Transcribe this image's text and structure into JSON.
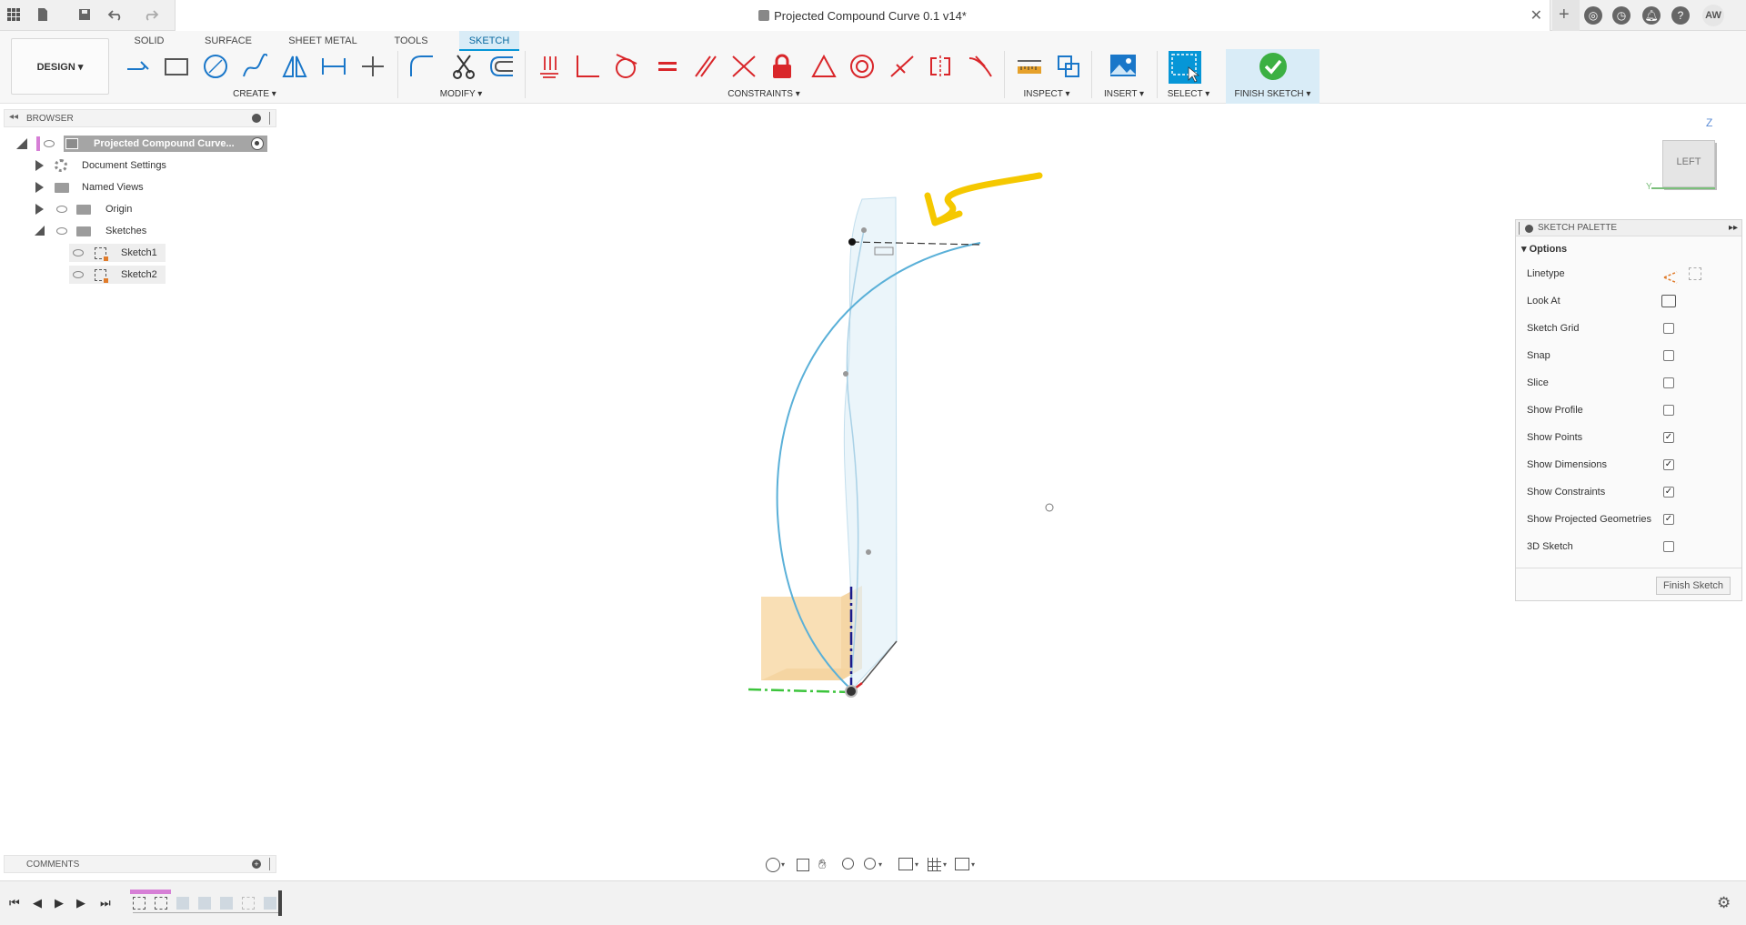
{
  "titlebar": {
    "doc_title": "Projected Compound Curve 0.1 v14*",
    "user_initials": "AW"
  },
  "toolbar": {
    "workspace_label": "DESIGN",
    "tabs": [
      "SOLID",
      "SURFACE",
      "SHEET METAL",
      "TOOLS",
      "SKETCH"
    ],
    "active_tab": "SKETCH",
    "groups": {
      "create": "CREATE",
      "modify": "MODIFY",
      "constraints": "CONSTRAINTS",
      "inspect": "INSPECT",
      "insert": "INSERT",
      "select": "SELECT",
      "finish": "FINISH SKETCH"
    }
  },
  "browser": {
    "header": "BROWSER",
    "root_label": "Projected Compound Curve...",
    "items": [
      {
        "label": "Document Settings"
      },
      {
        "label": "Named Views"
      },
      {
        "label": "Origin"
      },
      {
        "label": "Sketches"
      },
      {
        "label": "Sketch1"
      },
      {
        "label": "Sketch2"
      }
    ]
  },
  "palette": {
    "header": "SKETCH PALETTE",
    "section": "Options",
    "rows": [
      {
        "label": "Linetype",
        "control": "icons"
      },
      {
        "label": "Look At",
        "control": "icon"
      },
      {
        "label": "Sketch Grid",
        "checked": false
      },
      {
        "label": "Snap",
        "checked": false
      },
      {
        "label": "Slice",
        "checked": false
      },
      {
        "label": "Show Profile",
        "checked": false
      },
      {
        "label": "Show Points",
        "checked": true
      },
      {
        "label": "Show Dimensions",
        "checked": true
      },
      {
        "label": "Show Constraints",
        "checked": true
      },
      {
        "label": "Show Projected Geometries",
        "checked": true
      },
      {
        "label": "3D Sketch",
        "checked": false
      }
    ],
    "finish_button": "Finish Sketch"
  },
  "comments": {
    "label": "COMMENTS"
  },
  "viewcube": {
    "face_label": "LEFT",
    "axis_z": "Z",
    "axis_y": "Y"
  },
  "colors": {
    "accent": "#0696d7",
    "sketch_curve": "#5ab0d8",
    "annotation_arrow": "#f5c800",
    "finish_green": "#3cb043",
    "constraint_red": "#d9262a",
    "body_fill": "#f8d9a8"
  }
}
